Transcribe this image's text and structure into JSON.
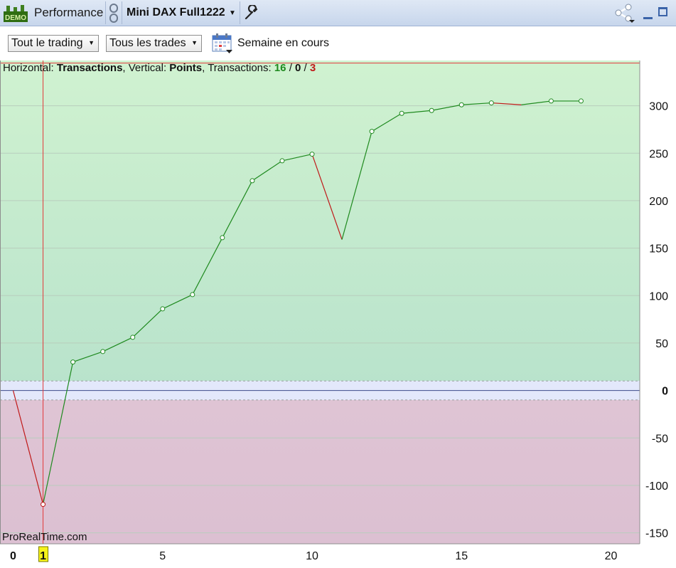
{
  "titlebar": {
    "app_badge": "DEMO",
    "panel_title": "Performance",
    "instrument": "Mini DAX Full1222"
  },
  "toolbar": {
    "scope_dropdown": "Tout le trading",
    "trades_dropdown": "Tous les trades",
    "period_label": "Semaine en cours"
  },
  "info": {
    "horizontal_prefix": "Horizontal: ",
    "horizontal_value": "Transactions",
    "vertical_prefix": ", Vertical: ",
    "vertical_value": "Points",
    "transactions_prefix": ", Transactions: ",
    "count_win": "16",
    "slash1": " / ",
    "count_even": "0",
    "slash2": " / ",
    "count_loss": "3"
  },
  "watermark": "ProRealTime.com",
  "colors": {
    "gain_zone": "#c7ecc9",
    "loss_zone": "#dfc4d4",
    "neutral_zone": "#e3e8fb",
    "line_up": "#1f8a1f",
    "line_down": "#c01818",
    "cursor": "#e23a3a"
  },
  "chart_data": {
    "type": "line",
    "x": [
      0,
      1,
      2,
      3,
      4,
      5,
      6,
      7,
      8,
      9,
      10,
      11,
      12,
      13,
      14,
      15,
      16,
      17,
      18,
      19
    ],
    "series": [
      {
        "values": [
          0,
          -120,
          30,
          41,
          56,
          86,
          101,
          161,
          221,
          242,
          249,
          159,
          273,
          292,
          295,
          301,
          303,
          301,
          305,
          305
        ]
      }
    ],
    "markers_hidden_at": [
      0,
      11,
      17
    ],
    "xlim": [
      0,
      21
    ],
    "ylim": [
      -162,
      347
    ],
    "x_ticks": [
      0,
      1,
      5,
      10,
      15,
      20
    ],
    "y_ticks": [
      -150,
      -100,
      -50,
      0,
      50,
      100,
      150,
      200,
      250,
      300
    ],
    "zero_band": [
      -10,
      10
    ],
    "cursor_x": 1,
    "top_line_y": 345,
    "grid": true
  }
}
